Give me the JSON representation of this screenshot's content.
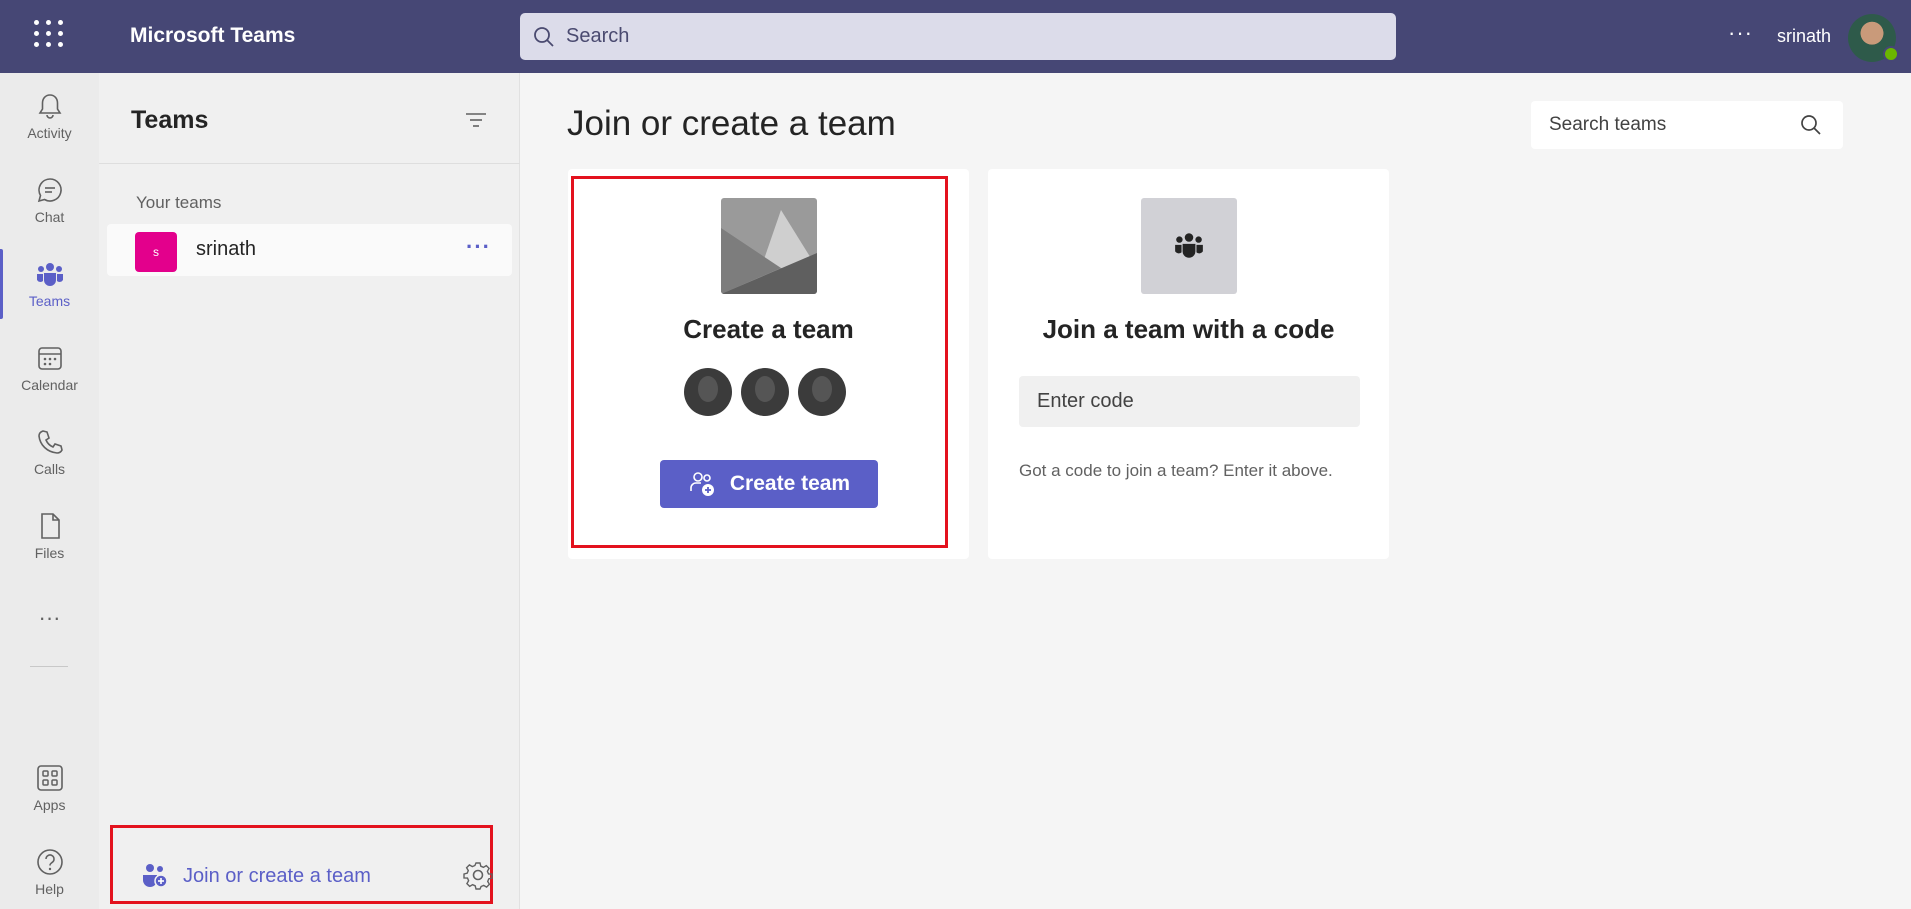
{
  "topbar": {
    "app_title": "Microsoft Teams",
    "search_placeholder": "Search",
    "more": "···",
    "user_name": "srinath"
  },
  "rail": {
    "items": [
      {
        "label": "Activity",
        "icon": "bell-icon"
      },
      {
        "label": "Chat",
        "icon": "chat-icon"
      },
      {
        "label": "Teams",
        "icon": "teams-icon"
      },
      {
        "label": "Calendar",
        "icon": "calendar-icon"
      },
      {
        "label": "Calls",
        "icon": "phone-icon"
      },
      {
        "label": "Files",
        "icon": "file-icon"
      },
      {
        "label": "Apps",
        "icon": "apps-icon"
      },
      {
        "label": "Help",
        "icon": "help-icon"
      }
    ],
    "more": "···"
  },
  "panel": {
    "title": "Teams",
    "section_label": "Your teams",
    "teams": [
      {
        "name": "srinath",
        "initial": "s",
        "color": "#e3008c",
        "more": "···"
      }
    ],
    "join_label": "Join or create a team"
  },
  "main": {
    "title": "Join or create a team",
    "search_placeholder": "Search teams",
    "create_card": {
      "title": "Create a team",
      "button_label": "Create team"
    },
    "join_card": {
      "title": "Join a team with a code",
      "input_placeholder": "Enter code",
      "hint": "Got a code to join a team? Enter it above."
    }
  },
  "colors": {
    "topbar": "#464775",
    "accent": "#5b5fc7",
    "highlight": "#e3121e"
  }
}
